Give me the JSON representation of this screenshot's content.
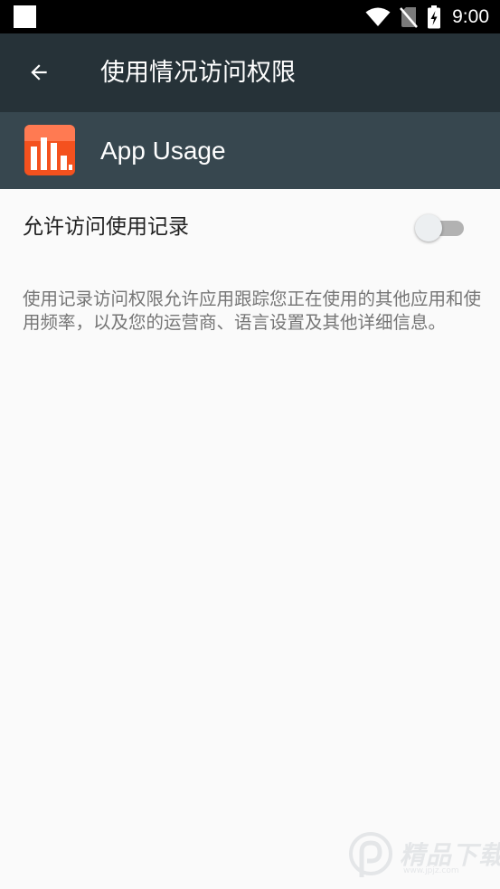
{
  "status_bar": {
    "time": "9:00",
    "icons": [
      "notification-square-icon",
      "wifi-icon",
      "no-sim-icon",
      "battery-charging-icon"
    ],
    "background": "#000000"
  },
  "toolbar": {
    "back_icon": "arrow-back-icon",
    "title": "使用情况访问权限",
    "background": "#263238"
  },
  "app": {
    "icon": "app-usage-bar-chart-icon",
    "name": "App Usage",
    "header_background": "#37474f",
    "icon_color": "#f4511e"
  },
  "setting": {
    "label": "允许访问使用记录",
    "enabled": false
  },
  "description": "使用记录访问权限允许应用跟踪您正在使用的其他应用和使用频率，以及您的运营商、语言设置及其他详细信息。",
  "watermark": {
    "text": "精品下载",
    "url": "www.jpjz.com"
  }
}
